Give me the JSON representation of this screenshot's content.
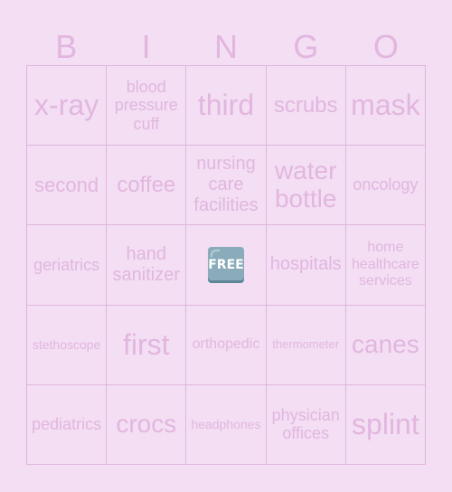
{
  "header": {
    "letters": [
      "B",
      "I",
      "N",
      "G",
      "O"
    ]
  },
  "free_label": "FREE",
  "colors": {
    "background": "#f3def3",
    "text": "#e2b6df",
    "free_badge": "#8aabba"
  },
  "cells": [
    "x-ray",
    "blood pressure cuff",
    "third",
    "scrubs",
    "mask",
    "second",
    "coffee",
    "nursing care facilities",
    "water bottle",
    "oncology",
    "geriatrics",
    "hand sanitizer",
    "FREE",
    "hospitals",
    "home healthcare services",
    "stethoscope",
    "first",
    "orthopedic",
    "thermometer",
    "canes",
    "pediatrics",
    "crocs",
    "headphones",
    "physician offices",
    "splint"
  ]
}
